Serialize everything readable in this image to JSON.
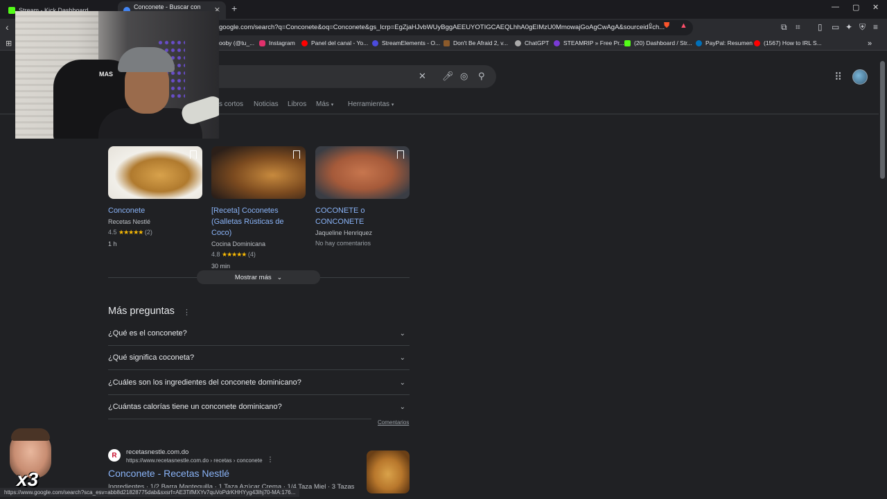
{
  "tabs": [
    {
      "title": "Stream - Kick Dashboard",
      "favicon_color": "#53fc18"
    },
    {
      "title": "Conconete - Buscar con Google",
      "favicon_color": "#4285f4"
    }
  ],
  "address_bar": {
    "url": "google.com/search?q=Conconete&oq=Conconete&gs_lcrp=EgZjaHJvbWUyBggAEEUYOTIGCAEQLhhA0gEIMzU0MmowajGoAgCwAgA&sourceid=ch..."
  },
  "bookmarks": [
    {
      "label": "ooby (@tu_...",
      "color": "#1d9bf0"
    },
    {
      "label": "Instagram",
      "color": "#e1306c"
    },
    {
      "label": "Panel del canal - Yo...",
      "color": "#ff0000"
    },
    {
      "label": "StreamElements - O...",
      "color": "#4b4bdc"
    },
    {
      "label": "Don't Be Afraid 2, v...",
      "color": "#8b5a2b"
    },
    {
      "label": "ChatGPT",
      "color": "#aaaaaa"
    },
    {
      "label": "STEAMRIP » Free Pr...",
      "color": "#7a3ad6"
    },
    {
      "label": "(20) Dashboard / Str...",
      "color": "#53fc18"
    },
    {
      "label": "PayPal: Resumen",
      "color": "#0070ba"
    },
    {
      "label": "(1567) How to IRL S...",
      "color": "#ff0000"
    }
  ],
  "search_tabs": [
    "s cortos",
    "Noticias",
    "Libros",
    "Más",
    "Herramientas"
  ],
  "recipes": [
    {
      "title": "Conconete",
      "source": "Recetas Nestlé",
      "rating": "4.5",
      "stars": "★★★★★",
      "count": "(2)",
      "time": "1 h",
      "img": "radial-gradient(ellipse at 55% 55%, #d8a24c 0%, #b07a2e 40%, #f1efe9 62%, #e6e2da 100%)"
    },
    {
      "title": "[Receta] Coconetes (Galletas Rústicas de Coco)",
      "source": "Cocina Dominicana",
      "rating": "4.8",
      "stars": "★★★★★",
      "count": "(4)",
      "time": "30 min",
      "img": "radial-gradient(ellipse at 65% 55%, #c78a3e 0%, #7b4a1f 45%, #2b1f19 85%)"
    },
    {
      "title": "COCONETE o CONCONETE",
      "source": "Jaqueline Henriquez",
      "rating": "",
      "stars": "",
      "count": "",
      "time": "",
      "no_reviews": "No hay comentarios",
      "img": "radial-gradient(ellipse at 50% 50%, #c7764e 0%, #a55a3a 45%, #3a3d44 85%)"
    }
  ],
  "show_more": "Mostrar más",
  "paa": {
    "title": "Más preguntas",
    "questions": [
      "¿Qué es el conconete?",
      "¿Qué significa coconeta?",
      "¿Cuáles son los ingredientes del conconete dominicano?",
      "¿Cuántas calorías tiene un conconete dominicano?"
    ],
    "feedback": "Comentarios"
  },
  "result": {
    "logo_letter": "R",
    "site": "recetasnestle.com.do",
    "url": "https://www.recetasnestle.com.do › recetas › conconete",
    "title": "Conconete - Recetas Nestlé",
    "snippet": "Ingredientes · 1/2 Barra Mantequilla · 1 Taza Azúcar Crema · 1/4 Taza Miel · 3 Tazas"
  },
  "status_url": "https://www.google.com/search?sca_esv=abb8d21828775dab&sxsrf=AE3TifMXYv7quVoPdrKHHYyg43lhj70-MA:176...",
  "overlay": {
    "cam_tag": "MAS",
    "emote_text": "x3"
  }
}
